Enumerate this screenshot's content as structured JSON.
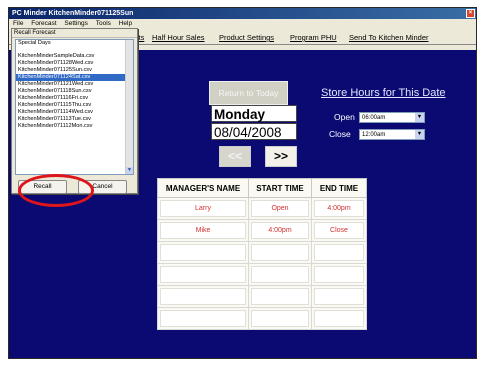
{
  "window": {
    "title": "PC Minder  KitchenMinder071125Sun",
    "close_label": "×"
  },
  "menu": [
    "File",
    "Forecast",
    "Settings",
    "Tools",
    "Help"
  ],
  "tabs": [
    "rts",
    "Half Hour Sales",
    "Product Settings",
    "Program PHU",
    "Send To Kitchen Minder"
  ],
  "recall_dialog": {
    "title": "Recall Forecast",
    "special_item": "Special Days",
    "files": [
      "KitchenMinderSampleData.csv",
      "KitchenMinder071128Wed.csv",
      "KitchenMinder071125Sun.csv",
      "KitchenMinder071124Sat.csv",
      "KitchenMinder071121Wed.csv",
      "KitchenMinder071118Sun.csv",
      "KitchenMinder071116Fri.csv",
      "KitchenMinder071115Thu.csv",
      "KitchenMinder071114Wed.csv",
      "KitchenMinder071113Tue.csv",
      "KitchenMinder071112Mon.csv"
    ],
    "selected_index": 3,
    "recall_label": "Recall",
    "cancel_label": "Cancel"
  },
  "date_panel": {
    "return_label": "Return to Today",
    "day": "Monday",
    "date": "08/04/2008",
    "prev_label": "<<",
    "next_label": ">>"
  },
  "store_hours": {
    "title": "Store Hours for This Date",
    "open_label": "Open",
    "open_value": "06:00am",
    "close_label": "Close",
    "close_value": "12:00am"
  },
  "schedule": {
    "headers": [
      "MANAGER'S NAME",
      "START TIME",
      "END TIME"
    ],
    "rows": [
      [
        "Larry",
        "Open",
        "4:00pm"
      ],
      [
        "Mike",
        "4:00pm",
        "Close"
      ],
      [
        "",
        "",
        ""
      ],
      [
        "",
        "",
        ""
      ],
      [
        "",
        "",
        ""
      ],
      [
        "",
        "",
        ""
      ]
    ]
  },
  "colors": {
    "background": "#0a0a72",
    "accent_red": "#e0141b",
    "selection": "#316ac5"
  }
}
